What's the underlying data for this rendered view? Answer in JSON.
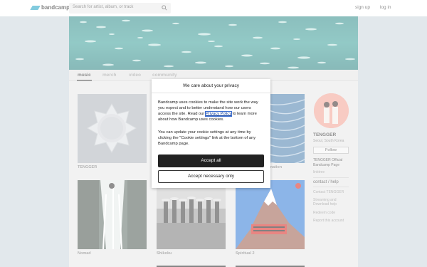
{
  "header": {
    "logo_text": "bandcamp",
    "search_placeholder": "Search for artist, album, or track",
    "signup_label": "sign up",
    "login_label": "log in"
  },
  "nav": {
    "tabs": [
      {
        "label": "music",
        "active": true
      },
      {
        "label": "merch",
        "active": false
      },
      {
        "label": "video",
        "active": false
      },
      {
        "label": "community",
        "active": false
      }
    ]
  },
  "albums": [
    {
      "title": "TENGGER"
    },
    {
      "title": ""
    },
    {
      "title": "...nation"
    },
    {
      "title": "Nomad"
    },
    {
      "title": "Shikoku"
    },
    {
      "title": "Spiritual 2"
    }
  ],
  "sidebar": {
    "artist_name": "TENGGER",
    "location": "Seoul, South Korea",
    "follow_label": "Follow",
    "official_page_label": "TENGGER Official Bandcamp Page",
    "short_link": "linktree",
    "contact_heading": "contact / help",
    "links": [
      "Contact TENGGER",
      "Streaming and Download help",
      "Redeem code",
      "Report this account"
    ]
  },
  "modal": {
    "title": "We care about your privacy",
    "para1_before": "Bandcamp uses cookies to make the site work the way you expect and to better understand how our users access the site. Read our ",
    "para1_link": "Privacy Policy",
    "para1_after": " to learn more about how Bandcamp uses cookies.",
    "para2": "You can update your cookie settings at any time by clicking the \"Cookie settings\" link at the bottom of any Bandcamp page.",
    "accept_all_label": "Accept all",
    "accept_necessary_label": "Accept necessary only"
  },
  "colors": {
    "brand": "#1da0c3",
    "accept_bg": "#222222",
    "link": "#0f3f9e"
  }
}
